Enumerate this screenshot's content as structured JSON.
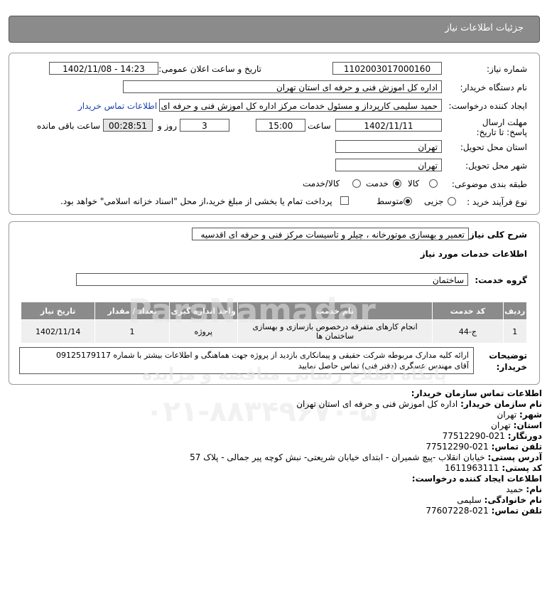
{
  "header": {
    "title": "جزئیات اطلاعات نیاز"
  },
  "form": {
    "need_number_label": "شماره نیاز:",
    "need_number": "1102003017000160",
    "announce_label": "تاریخ و ساعت اعلان عمومی:",
    "announce_value": "1402/11/08 - 14:23",
    "buyer_org_label": "نام دستگاه خریدار:",
    "buyer_org": "اداره کل اموزش فنی و حرفه ای استان تهران",
    "requester_label": "ایجاد کننده درخواست:",
    "requester": "حمید سلیمی کارپرداز و مسئول خدمات مرکز اداره کل اموزش فنی و حرفه ای اس",
    "contact_link": "اطلاعات تماس خریدار",
    "deadline_label": "مهلت ارسال پاسخ: تا تاریخ:",
    "deadline_date": "1402/11/11",
    "time_label": "ساعت",
    "deadline_time": "15:00",
    "days_value": "3",
    "days_label": "روز و",
    "remaining_time": "00:28:51",
    "remaining_label": "ساعت باقی مانده",
    "province_label": "استان محل تحویل:",
    "province": "تهران",
    "city_label": "شهر محل تحویل:",
    "city": "تهران",
    "category_label": "طبقه بندی موضوعی:",
    "category_options": [
      "کالا",
      "خدمت",
      "کالا/خدمت"
    ],
    "category_selected": "خدمت",
    "process_label": "نوع فرآیند خرید :",
    "process_options": [
      "جزیی",
      "متوسط"
    ],
    "process_selected": "متوسط",
    "treasury_text": "پرداخت تمام یا بخشی از مبلغ خرید،از محل \"اسناد خزانه اسلامی\" خواهد بود."
  },
  "description": {
    "label": "شرح کلی نیاز:",
    "value": "تعمیر و بهسازی موتورخانه ، چیلر و تاسیسات مرکز فنی و حرفه ای اقدسیه"
  },
  "services": {
    "section_title": "اطلاعات خدمات مورد نیاز",
    "group_label": "گروه خدمت:",
    "group_value": "ساختمان",
    "columns": [
      "ردیف",
      "کد خدمت",
      "نام خدمت",
      "واحد اندازه گیری",
      "تعداد / مقدار",
      "تاریخ نیاز"
    ],
    "rows": [
      {
        "row": "1",
        "code": "ج-44",
        "name": "انجام کارهای متفرقه درخصوص بازسازی و بهسازی ساختمان ها",
        "unit": "پروژه",
        "qty": "1",
        "date": "1402/11/14"
      }
    ]
  },
  "buyer_notes": {
    "label": "توضیحات خریدار:",
    "line1": "ارائه کلیه مدارک مربوطه شرکت حقیقی و پیمانکاری بازدید از پروژه جهت هماهنگی و اطلاعات بیشتر با شماره 09125179117",
    "line2": "آقای مهندس عسگری (دفتر فنی) تماس حاصل نمایید"
  },
  "contact": {
    "title": "اطلاعات تماس سازمان خریدار:",
    "org_label": "نام سازمان خریدار:",
    "org": "اداره کل اموزش فنی و حرفه ای استان تهران",
    "city_label": "شهر:",
    "city": "تهران",
    "province_label": "استان:",
    "province": "تهران",
    "fax_label": "دورنگار:",
    "fax": "021-77512290",
    "phone_label": "تلفن تماس:",
    "phone": "021-77512290",
    "address_label": "آدرس پستی:",
    "address": "خیابان انقلاب -پیچ شمیران - ابتدای خیابان شریعتی- نبش کوچه پیر جمالی - پلاک 57",
    "postal_label": "کد پستی:",
    "postal": "1611963111",
    "creator_title": "اطلاعات ایجاد کننده درخواست:",
    "name_label": "نام:",
    "name": "حمید",
    "family_label": "نام خانوادگی:",
    "family": "سلیمی",
    "creator_phone_label": "تلفن تماس:",
    "creator_phone": "021-77607228"
  },
  "watermark": {
    "brand": "ParsNamadar",
    "site": "پایگاه اطلاع رسانی مناقصه و مزایده",
    "phone": "۰۲۱-۸۸۳۴۹۶۷۰-۵"
  }
}
